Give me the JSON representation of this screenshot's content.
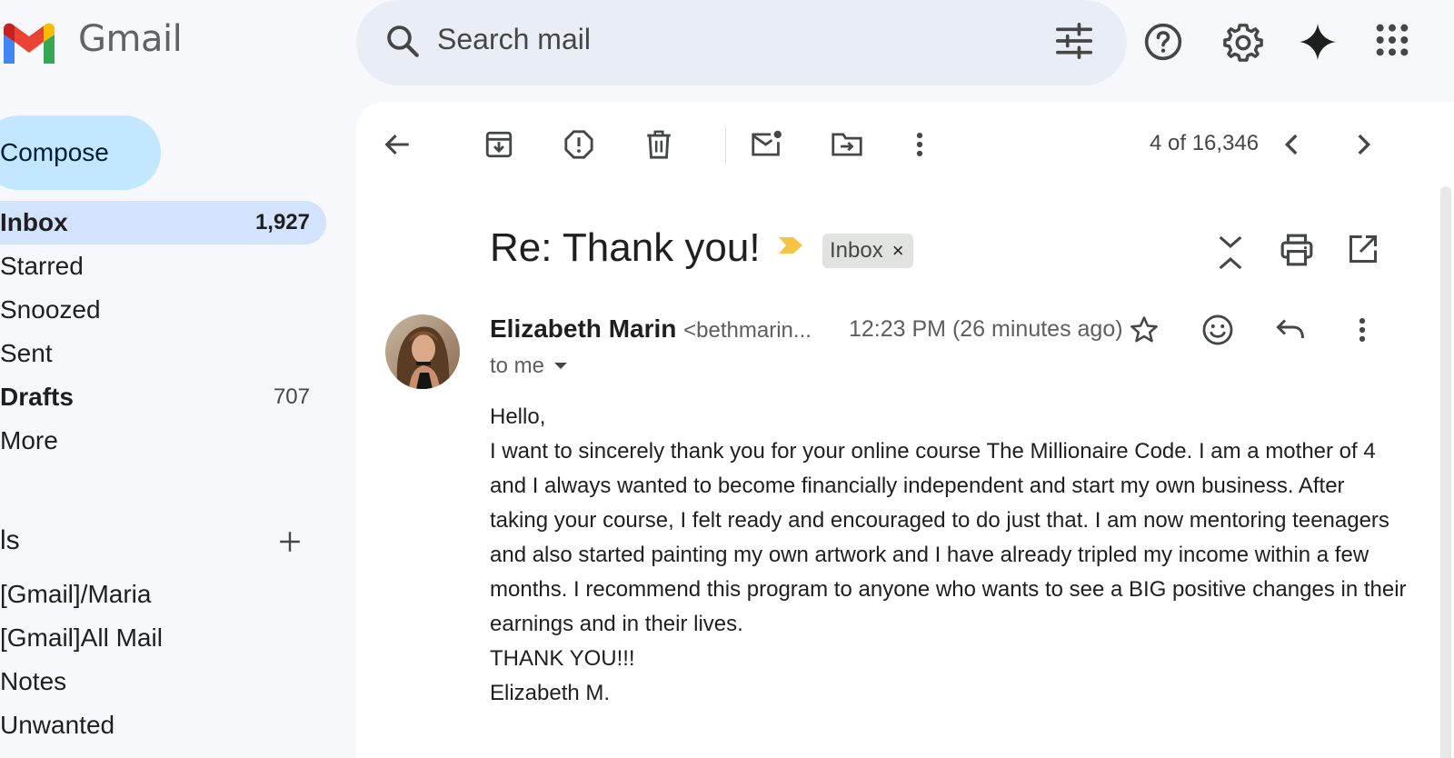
{
  "app": {
    "name": "Gmail"
  },
  "search": {
    "placeholder": "Search mail"
  },
  "sidebar": {
    "compose_label": "Compose",
    "items": [
      {
        "label": "Inbox",
        "count": "1,927"
      },
      {
        "label": "Starred",
        "count": ""
      },
      {
        "label": "Snoozed",
        "count": ""
      },
      {
        "label": "Sent",
        "count": ""
      },
      {
        "label": "Drafts",
        "count": "707"
      },
      {
        "label": "More",
        "count": ""
      }
    ],
    "labels_heading": "ls",
    "labels": [
      "[Gmail]/Maria",
      "[Gmail]All Mail",
      "Notes",
      "Unwanted"
    ]
  },
  "toolbar": {
    "pager": "4 of 16,346"
  },
  "message": {
    "subject": "Re: Thank you!",
    "label_chip": "Inbox",
    "label_chip_remove": "×",
    "sender_name": "Elizabeth Marin",
    "sender_email": "<bethmarin...",
    "timestamp": "12:23 PM (26 minutes ago)",
    "recipient": "to me",
    "body": [
      "Hello,",
      "I want to sincerely thank you for your online course The Millionaire Code. I am a mother of 4 and I always wanted to become financially independent and start my own business. After taking your course, I felt ready and encouraged to do just that. I am now mentoring teenagers and also started painting my own artwork and I have already tripled my income within a few months. I recommend this program to anyone who wants to see a BIG positive changes in their earnings and in their lives.",
      "THANK YOU!!!",
      "Elizabeth M."
    ]
  },
  "icons": {
    "header": [
      "search-icon",
      "filter-icon",
      "help-icon",
      "settings-icon",
      "gemini-icon",
      "apps-icon"
    ],
    "toolbar": [
      "back-arrow-icon",
      "archive-icon",
      "report-spam-icon",
      "delete-icon",
      "mark-unread-icon",
      "move-to-icon",
      "more-vert-icon",
      "prev-icon",
      "next-icon"
    ],
    "subject": [
      "importance-marker-icon",
      "expand-collapse-icon",
      "print-icon",
      "open-new-window-icon"
    ],
    "message": [
      "star-icon",
      "emoji-icon",
      "reply-icon",
      "more-vert-icon",
      "dropdown-arrow-icon"
    ]
  },
  "colors": {
    "background": "#f6f8fc",
    "compose": "#c2e7ff",
    "active_nav": "#d3e3fd",
    "search_bg": "#e9eef6",
    "importance": "#f6c344",
    "gmail_red": "#ea4335",
    "gmail_blue": "#4285f4",
    "gmail_green": "#34a853",
    "gmail_yellow": "#fbbc04"
  }
}
